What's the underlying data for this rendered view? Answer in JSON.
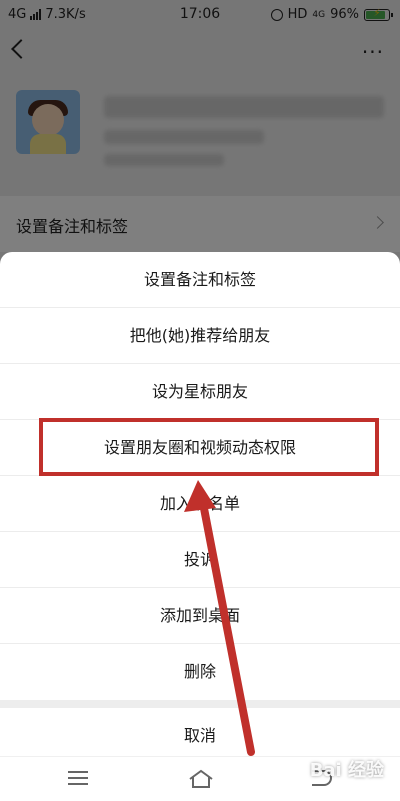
{
  "status_bar": {
    "network": "4G",
    "speed": "7.3K/s",
    "time": "17:06",
    "hd": "HD",
    "network_right": "4G",
    "battery": "96%",
    "battery_level": 0.96
  },
  "profile": {
    "remark_row_label": "设置备注和标签"
  },
  "action_sheet": {
    "items": [
      "设置备注和标签",
      "把他(她)推荐给朋友",
      "设为星标朋友",
      "设置朋友圈和视频动态权限",
      "加入黑名单",
      "投诉",
      "添加到桌面",
      "删除"
    ],
    "cancel": "取消"
  },
  "annotation": {
    "highlight_color": "#c0302b"
  },
  "watermark": "Bai 经验"
}
